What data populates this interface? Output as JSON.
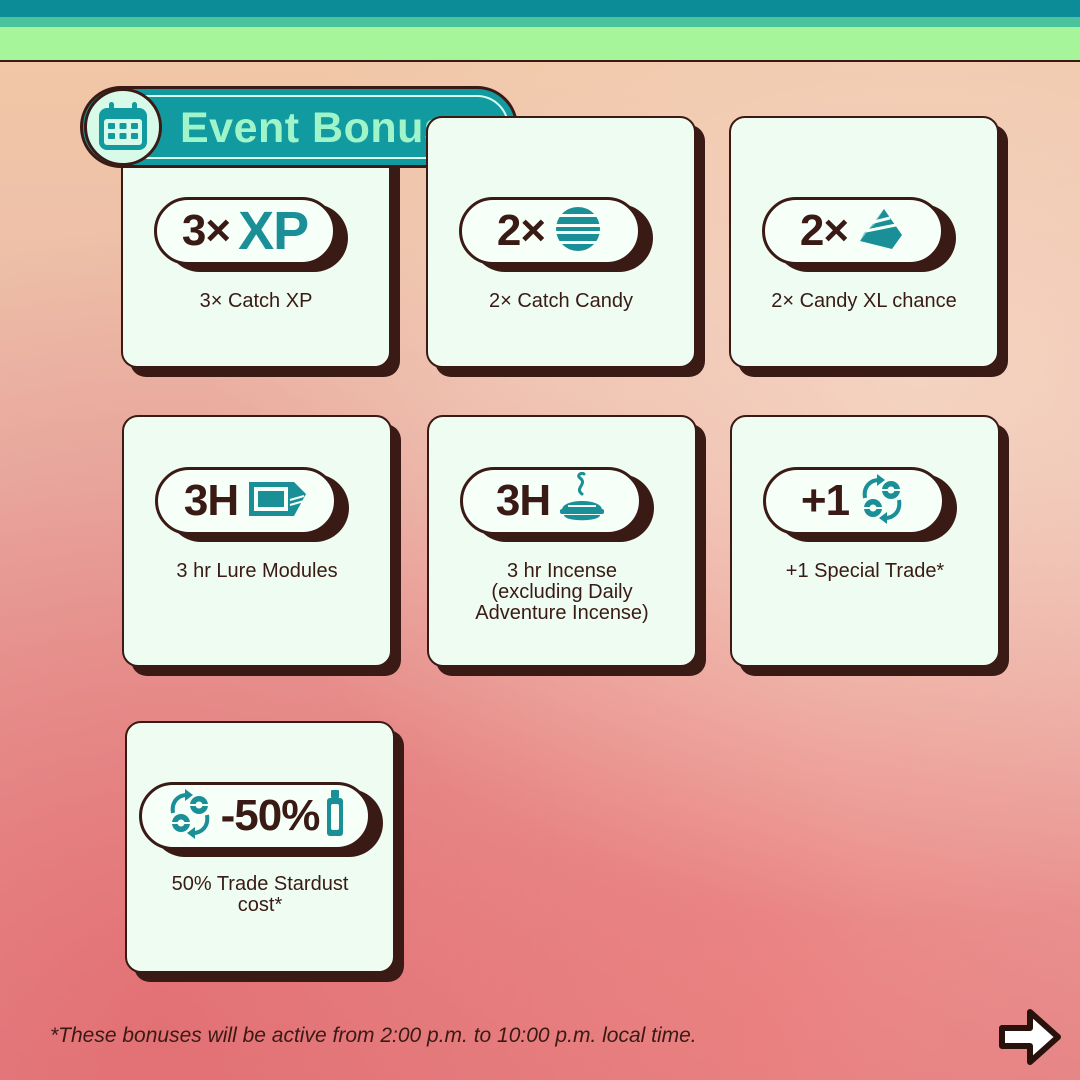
{
  "header": {
    "title": "Event Bonuses",
    "icon": "calendar-icon"
  },
  "colors": {
    "teal": "#119a9f",
    "mint_text": "#9ff5c9",
    "card_bg": "#eefcf2",
    "outline": "#3a1a14",
    "top_green": "#a6f59a"
  },
  "cards": [
    {
      "badge_multiplier": "3×",
      "badge_extra": "XP",
      "label": "3× Catch XP",
      "icon": "xp-text"
    },
    {
      "badge_multiplier": "2×",
      "label": "2× Catch Candy",
      "icon": "candy-icon"
    },
    {
      "badge_multiplier": "2×",
      "label": "2× Candy XL chance",
      "icon": "candy-xl-icon"
    },
    {
      "badge_multiplier": "3H",
      "label": "3 hr Lure Modules",
      "icon": "lure-module-icon"
    },
    {
      "badge_multiplier": "3H",
      "label_lines": [
        "3 hr Incense",
        "(excluding Daily",
        "Adventure Incense)"
      ],
      "icon": "incense-icon"
    },
    {
      "badge_multiplier": "+1",
      "label": "+1 Special Trade*",
      "icon": "trade-icon"
    },
    {
      "badge_multiplier": "-50%",
      "label_lines": [
        "50% Trade Stardust",
        "cost*"
      ],
      "icon": "trade-icon",
      "icon2": "stardust-icon"
    }
  ],
  "footnote": "*These bonuses will be active from 2:00 p.m. to 10:00 p.m. local time.",
  "next_icon": "right-arrow-icon"
}
